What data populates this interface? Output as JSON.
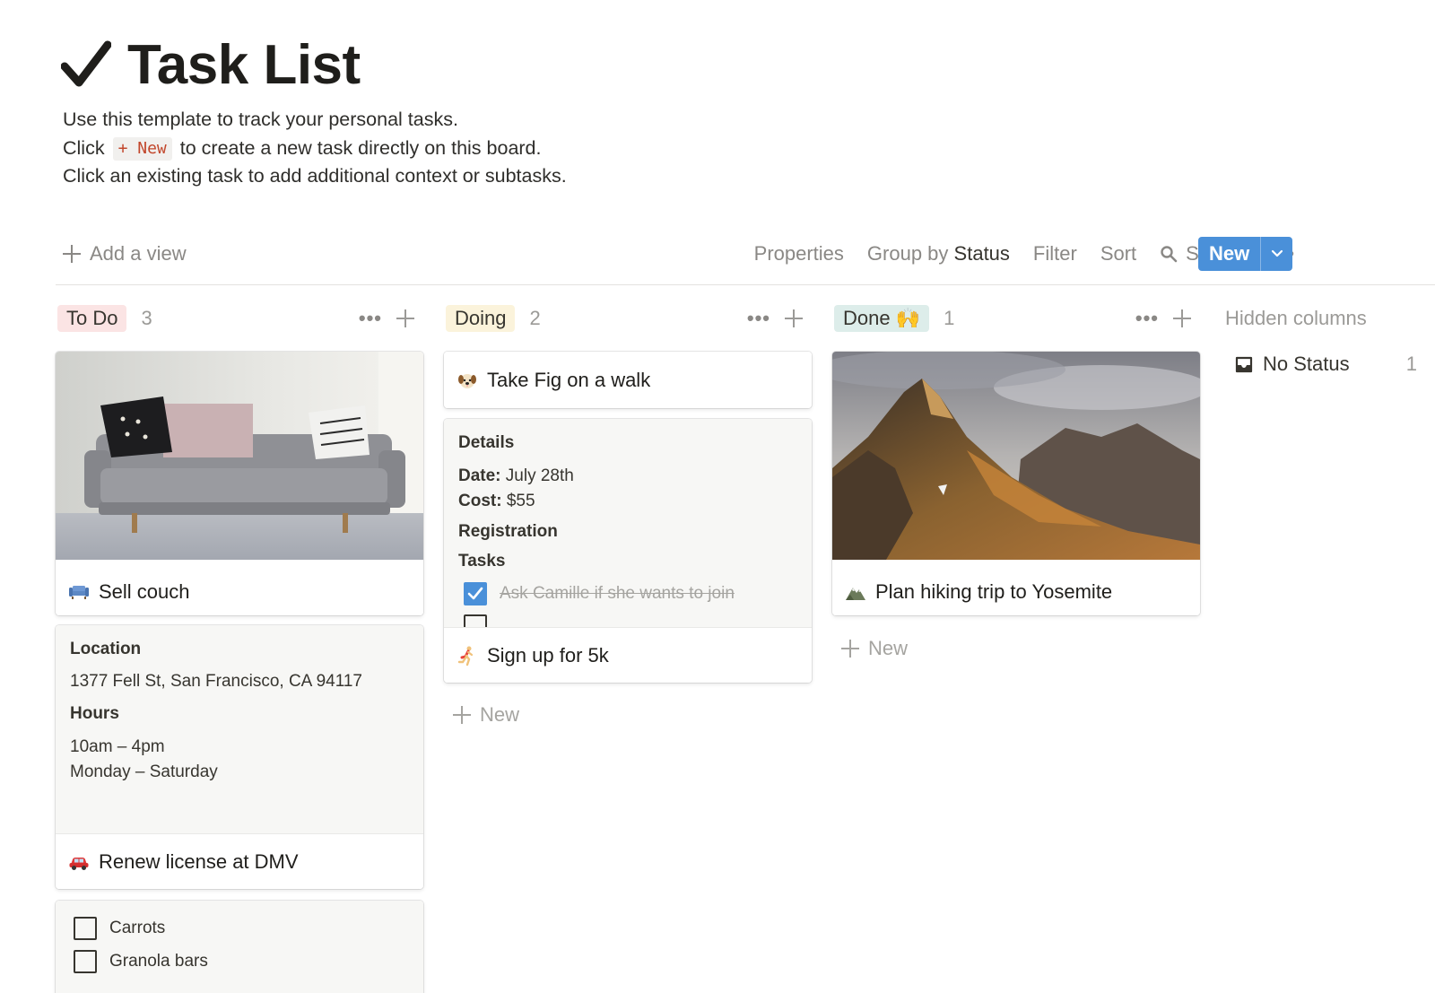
{
  "page": {
    "title": "Task List",
    "description": {
      "line1": "Use this template to track your personal tasks.",
      "line2_before": "Click",
      "line2_chip": "+ New",
      "line2_after": "to create a new task directly on this board.",
      "line3": "Click an existing task to add additional context or subtasks."
    }
  },
  "toolbar": {
    "add_view": "Add a view",
    "properties": "Properties",
    "group_by_label": "Group by",
    "group_by_value": "Status",
    "filter": "Filter",
    "sort": "Sort",
    "search": "Search",
    "new_button": "New"
  },
  "columns": [
    {
      "name": "To Do",
      "count": "3",
      "color": "#fbe4e4",
      "cards": {
        "couch": {
          "title": "Sell couch",
          "icon": "couch-icon"
        },
        "dmv": {
          "location_heading": "Location",
          "address": "1377 Fell St, San Francisco, CA 94117",
          "hours_heading": "Hours",
          "hours": "10am – 4pm",
          "days": "Monday – Saturday",
          "title": "Renew license at DMV",
          "icon": "car-icon"
        },
        "groceries": {
          "items": [
            "Carrots",
            "Granola bars"
          ]
        }
      }
    },
    {
      "name": "Doing",
      "count": "2",
      "color": "#fbf3db",
      "cards": {
        "fig": {
          "title": "Take Fig on a walk",
          "icon": "dog-icon"
        },
        "run": {
          "details_heading": "Details",
          "date_label": "Date:",
          "date_value": "July 28th",
          "cost_label": "Cost:",
          "cost_value": "$55",
          "registration_heading": "Registration",
          "tasks_heading": "Tasks",
          "task1": "Ask Camille if she wants to join",
          "title": "Sign up for 5k",
          "icon": "runner-icon"
        }
      },
      "add_new": "New"
    },
    {
      "name": "Done 🙌",
      "count": "1",
      "color": "#ddedea",
      "cards": {
        "hike": {
          "title": "Plan hiking trip to Yosemite",
          "icon": "mountain-icon"
        }
      },
      "add_new": "New"
    }
  ],
  "hidden_columns": {
    "title": "Hidden columns",
    "no_status": "No Status",
    "no_status_count": "1"
  },
  "colors": {
    "accent": "#4a90d9"
  }
}
